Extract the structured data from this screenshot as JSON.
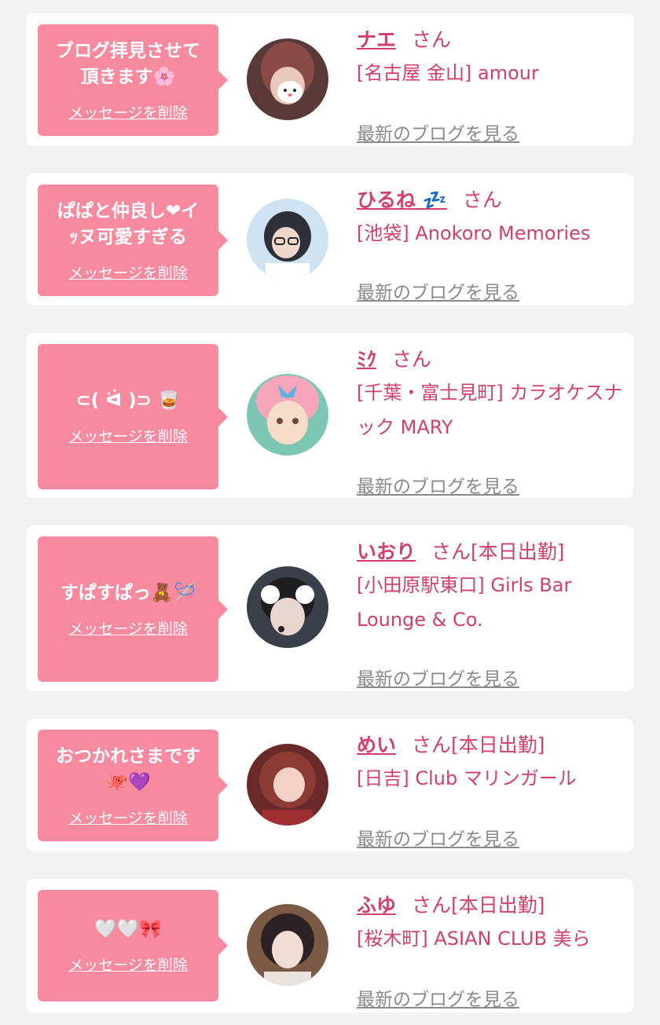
{
  "delete_label": "メッセージを削除",
  "blog_label": "最新のブログを見る",
  "cards": [
    {
      "message": "ブログ拝見させて\n頂きます🌸",
      "name": "ナエ",
      "suffix": "さん",
      "shop": "[名古屋 金山] amour"
    },
    {
      "message": "ぱぱと仲良し❤イ\nｯヌ可愛すぎる",
      "name": "ひるね 💤",
      "suffix": "さん",
      "shop": "[池袋] Anokoro Memories"
    },
    {
      "message": "⊂( ᐛ )⊃ 🥃",
      "name": "ﾐｸ",
      "suffix": "さん",
      "shop": "[千葉・富士見町] カラオケスナック MARY"
    },
    {
      "message": "すぱすぱっ🧸🪡",
      "name": "いおり",
      "suffix": "さん[本日出勤]",
      "shop": "[小田原駅東口] Girls Bar Lounge & Co."
    },
    {
      "message": "おつかれさまです\n🐙💜",
      "name": "めい",
      "suffix": "さん[本日出勤]",
      "shop": "[日吉] Club マリンガール"
    },
    {
      "message": "🤍🤍🎀",
      "name": "ふゆ",
      "suffix": "さん[本日出勤]",
      "shop": "[桜木町] ASIAN CLUB 美ら"
    }
  ]
}
